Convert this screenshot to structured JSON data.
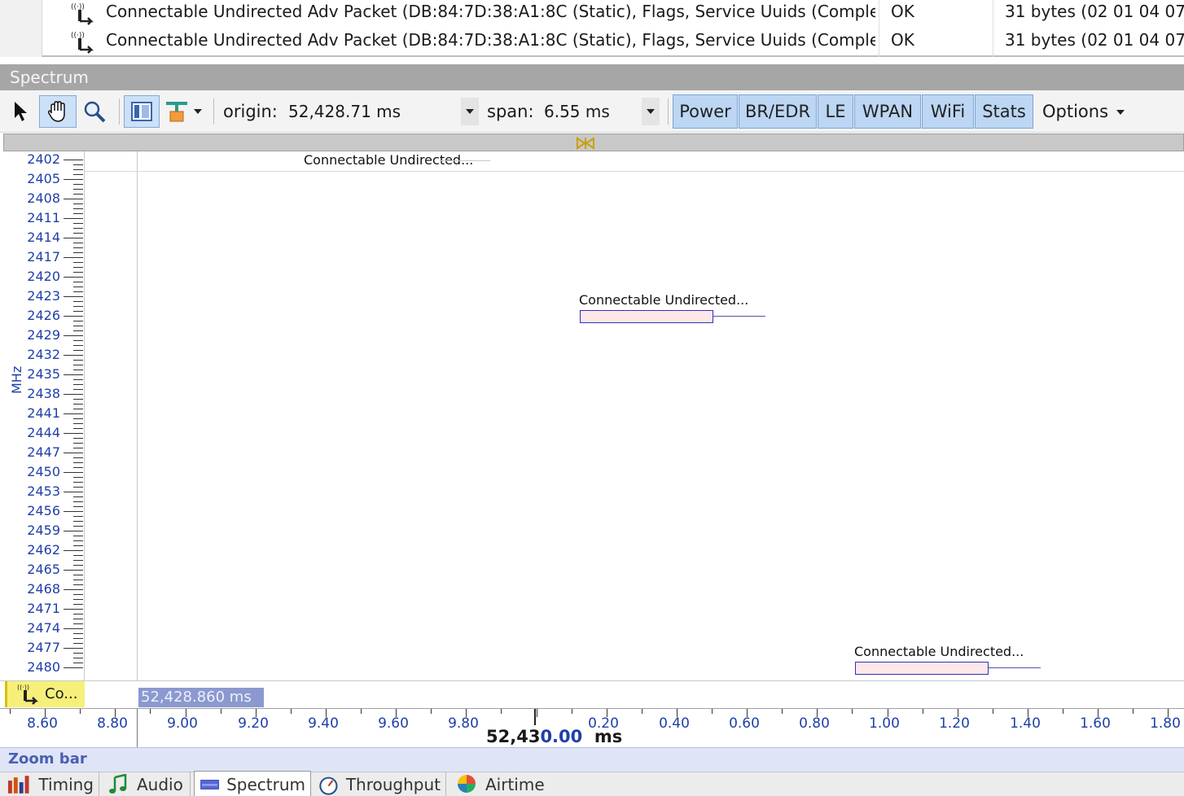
{
  "packet_list": {
    "rows": [
      {
        "description": "Connectable Undirected Adv Packet (DB:84:7D:38:A1:8C (Static), Flags, Service Uuids (Comple...",
        "status": "OK",
        "data": "31 bytes (02 01 04 07 0"
      },
      {
        "description": "Connectable Undirected Adv Packet (DB:84:7D:38:A1:8C (Static), Flags, Service Uuids (Comple...",
        "status": "OK",
        "data": "31 bytes (02 01 04 07 0"
      }
    ]
  },
  "spectrum": {
    "title": "Spectrum"
  },
  "toolbar": {
    "origin_label": "origin:",
    "origin_value": "52,428.71 ms",
    "span_label": "span:",
    "span_value": "6.55 ms",
    "filters": [
      "Power",
      "BR/EDR",
      "LE",
      "WPAN",
      "WiFi",
      "Stats"
    ],
    "options_label": "Options",
    "icons": [
      "pointer-icon",
      "pan-hand-icon",
      "zoom-magnifier-icon",
      "split-view-icon",
      "marker-icon"
    ]
  },
  "plot": {
    "y_axis_unit": "MHz",
    "y_ticks": [
      "2402",
      "2405",
      "2408",
      "2411",
      "2414",
      "2417",
      "2420",
      "2423",
      "2426",
      "2429",
      "2432",
      "2435",
      "2438",
      "2441",
      "2444",
      "2447",
      "2450",
      "2453",
      "2456",
      "2459",
      "2462",
      "2465",
      "2468",
      "2471",
      "2474",
      "2477",
      "2480"
    ],
    "packets": [
      {
        "label": "Connectable  Undirected...",
        "channel_mhz": 2402
      },
      {
        "label": "Connectable  Undirected...",
        "channel_mhz": 2426
      },
      {
        "label": "Connectable  Undirected...",
        "channel_mhz": 2480
      }
    ]
  },
  "selection": {
    "chip_text": "Co...",
    "cursor_time": "52,428.860 ms"
  },
  "time_axis": {
    "ticks": [
      "8.60",
      "8.80",
      "9.00",
      "9.20",
      "9.40",
      "9.60",
      "9.80",
      "0.20",
      "0.40",
      "0.60",
      "0.80",
      "1.00",
      "1.20",
      "1.40",
      "1.60",
      "1.80"
    ],
    "center_prefix": "52,43",
    "center_highlight": "0.00",
    "center_unit": "ms"
  },
  "zoom_bar": {
    "label": "Zoom bar"
  },
  "tabs": [
    {
      "label": "Timing",
      "icon": "timing-icon",
      "active": false
    },
    {
      "label": "Audio",
      "icon": "music-note-icon",
      "active": false
    },
    {
      "label": "Spectrum",
      "icon": "spectrum-icon",
      "active": true
    },
    {
      "label": "Throughput",
      "icon": "gauge-icon",
      "active": false
    },
    {
      "label": "Airtime",
      "icon": "pie-balloon-icon",
      "active": false
    }
  ]
}
